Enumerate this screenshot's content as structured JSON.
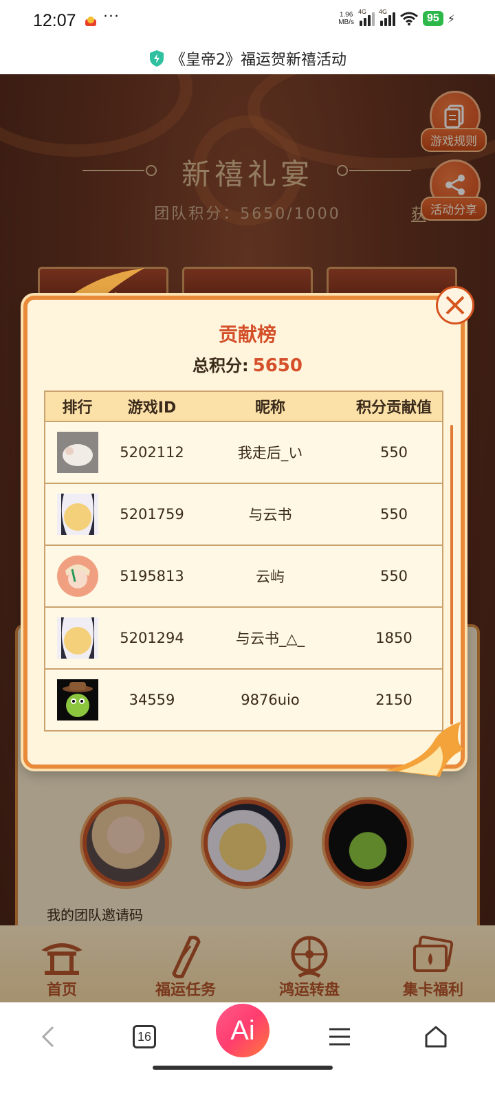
{
  "status_bar": {
    "time": "12:07",
    "dots": "···",
    "net_speed_value": "1.96",
    "net_speed_unit": "MB/s",
    "signal1_label": "4G",
    "signal2_label": "4G",
    "battery": "95"
  },
  "title_bar": {
    "title": "《皇帝2》福运贺新禧活动"
  },
  "game": {
    "heading": "新禧礼宴",
    "team_score": "团队积分：5650/1000",
    "obtain_link": "获",
    "rules_button": "游戏规则",
    "share_button": "活动分享",
    "invite_label": "我的团队邀请码"
  },
  "modal": {
    "title": "贡献榜",
    "total_label": "总积分:",
    "total_value": "5650",
    "columns": [
      "排行",
      "游戏ID",
      "昵称",
      "积分贡献值"
    ],
    "rows": [
      {
        "game_id": "5202112",
        "nickname": "我走后_い",
        "points": "550",
        "avatar": "cat-photo-avatar"
      },
      {
        "game_id": "5201759",
        "nickname": "与云书",
        "points": "550",
        "avatar": "moon-girl-avatar"
      },
      {
        "game_id": "5195813",
        "nickname": "云屿",
        "points": "550",
        "avatar": "anime-boy-avatar"
      },
      {
        "game_id": "5201294",
        "nickname": "与云书_△_",
        "points": "1850",
        "avatar": "moon-girl-avatar"
      },
      {
        "game_id": "34559",
        "nickname": "9876uio",
        "points": "2150",
        "avatar": "green-cowboy-avatar"
      }
    ]
  },
  "bottom_nav": [
    {
      "label": "首页",
      "icon": "pavilion-icon"
    },
    {
      "label": "福运任务",
      "icon": "scroll-icon"
    },
    {
      "label": "鸿运转盘",
      "icon": "wheel-icon"
    },
    {
      "label": "集卡福利",
      "icon": "cards-icon"
    }
  ],
  "browser_bar": {
    "tab_count": "16",
    "ai_label": "Ai"
  },
  "colors": {
    "accent": "#d4502a",
    "panel": "#fff5dc",
    "border": "#e88a3a"
  }
}
